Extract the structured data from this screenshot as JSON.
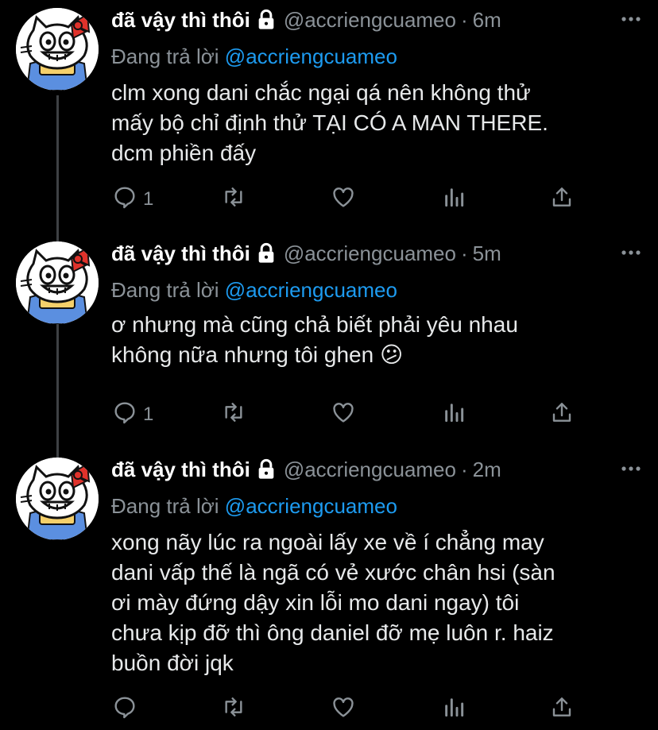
{
  "tweets": [
    {
      "name": "đã vậy thì thôi",
      "handle": "@accriengcuameo",
      "dot": "·",
      "time": "6m",
      "reply_prefix": "Đang trả lời",
      "reply_to": "@accriengcuameo",
      "text_lines": [
        "clm xong dani chắc ngại qá nên không thử",
        "mấy bộ chỉ định thử TẠI CÓ A MAN THERE.",
        "dcm phiền đấy"
      ],
      "reply_count": "1"
    },
    {
      "name": "đã vậy thì thôi",
      "handle": "@accriengcuameo",
      "dot": "·",
      "time": "5m",
      "reply_prefix": "Đang trả lời",
      "reply_to": "@accriengcuameo",
      "text_lines": [
        "ơ nhưng mà cũng chả biết phải yêu nhau",
        "không nữa nhưng tôi ghen 😕"
      ],
      "reply_count": "1"
    },
    {
      "name": "đã vậy thì thôi",
      "handle": "@accriengcuameo",
      "dot": "·",
      "time": "2m",
      "reply_prefix": "Đang trả lời",
      "reply_to": "@accriengcuameo",
      "text_lines": [
        "xong nãy lúc ra ngoài lấy xe về í chẳng may",
        "dani vấp thế là ngã có vẻ xước chân hsi (sàn",
        "ơi mày đứng dậy xin lỗi mo dani ngay) tôi",
        "chưa kịp đỡ thì ông daniel đỡ mẹ luôn r. haiz",
        "buồn đời jqk"
      ],
      "reply_count": ""
    }
  ],
  "colors": {
    "background": "#000000",
    "name": "#ffffff",
    "secondary": "#8b9298",
    "mention": "#1d9bf0",
    "thread_line": "#3e4144"
  },
  "icons": {
    "lock": "lock-icon",
    "more": "more-icon",
    "reply": "reply-icon",
    "retweet": "retweet-icon",
    "like": "like-icon",
    "analytics": "analytics-icon",
    "share": "share-icon"
  }
}
